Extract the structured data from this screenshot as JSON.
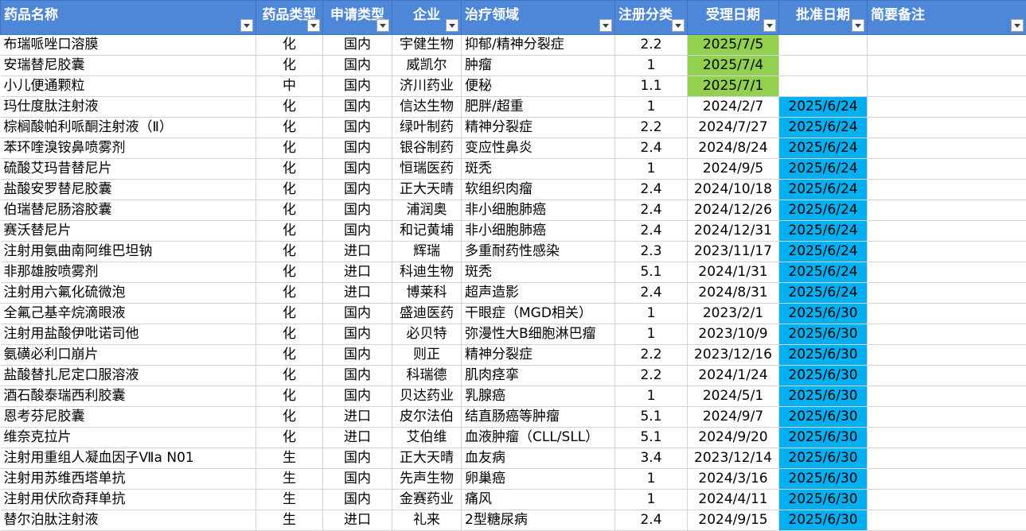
{
  "columns": [
    "药品名称",
    "药品类型",
    "申请类型",
    "企业",
    "治疗领域",
    "注册分类",
    "受理日期",
    "批准日期",
    "简要备注"
  ],
  "colors": {
    "header": "#4e86d8",
    "accepted_highlight": "#92d050",
    "approved_highlight": "#00b0f0"
  },
  "icons": {
    "filter": "chevron-down-icon"
  },
  "rows": [
    {
      "name": "布瑞哌唑口溶膜",
      "drug_type": "化",
      "app_type": "国内",
      "company": "宇健生物",
      "area": "抑郁/精神分裂症",
      "reg_class": "2.2",
      "accept_date": "2025/7/5",
      "approve_date": "",
      "note": ""
    },
    {
      "name": "安瑞替尼胶囊",
      "drug_type": "化",
      "app_type": "国内",
      "company": "威凯尔",
      "area": "肿瘤",
      "reg_class": "1",
      "accept_date": "2025/7/4",
      "approve_date": "",
      "note": ""
    },
    {
      "name": "小儿便通颗粒",
      "drug_type": "中",
      "app_type": "国内",
      "company": "济川药业",
      "area": "便秘",
      "reg_class": "1.1",
      "accept_date": "2025/7/1",
      "approve_date": "",
      "note": ""
    },
    {
      "name": "玛仕度肽注射液",
      "drug_type": "化",
      "app_type": "国内",
      "company": "信达生物",
      "area": "肥胖/超重",
      "reg_class": "1",
      "accept_date": "2024/2/7",
      "approve_date": "2025/6/24",
      "note": ""
    },
    {
      "name": "棕榈酸帕利哌酮注射液（Ⅱ）",
      "drug_type": "化",
      "app_type": "国内",
      "company": "绿叶制药",
      "area": "精神分裂症",
      "reg_class": "2.2",
      "accept_date": "2024/7/27",
      "approve_date": "2025/6/24",
      "note": ""
    },
    {
      "name": "苯环喹溴铵鼻喷雾剂",
      "drug_type": "化",
      "app_type": "国内",
      "company": "银谷制药",
      "area": "变应性鼻炎",
      "reg_class": "2.4",
      "accept_date": "2024/8/24",
      "approve_date": "2025/6/24",
      "note": ""
    },
    {
      "name": "硫酸艾玛昔替尼片",
      "drug_type": "化",
      "app_type": "国内",
      "company": "恒瑞医药",
      "area": "斑秃",
      "reg_class": "1",
      "accept_date": "2024/9/5",
      "approve_date": "2025/6/24",
      "note": ""
    },
    {
      "name": "盐酸安罗替尼胶囊",
      "drug_type": "化",
      "app_type": "国内",
      "company": "正大天晴",
      "area": "软组织肉瘤",
      "reg_class": "2.4",
      "accept_date": "2024/10/18",
      "approve_date": "2025/6/24",
      "note": ""
    },
    {
      "name": "伯瑞替尼肠溶胶囊",
      "drug_type": "化",
      "app_type": "国内",
      "company": "浦润奥",
      "area": "非小细胞肺癌",
      "reg_class": "2.4",
      "accept_date": "2024/12/26",
      "approve_date": "2025/6/24",
      "note": ""
    },
    {
      "name": "赛沃替尼片",
      "drug_type": "化",
      "app_type": "国内",
      "company": "和记黄埔",
      "area": "非小细胞肺癌",
      "reg_class": "2.4",
      "accept_date": "2024/12/31",
      "approve_date": "2025/6/24",
      "note": ""
    },
    {
      "name": "注射用氨曲南阿维巴坦钠",
      "drug_type": "化",
      "app_type": "进口",
      "company": "辉瑞",
      "area": "多重耐药性感染",
      "reg_class": "2.3",
      "accept_date": "2023/11/17",
      "approve_date": "2025/6/24",
      "note": ""
    },
    {
      "name": "非那雄胺喷雾剂",
      "drug_type": "化",
      "app_type": "进口",
      "company": "科迪生物",
      "area": "斑秃",
      "reg_class": "5.1",
      "accept_date": "2024/1/31",
      "approve_date": "2025/6/24",
      "note": ""
    },
    {
      "name": "注射用六氟化硫微泡",
      "drug_type": "化",
      "app_type": "进口",
      "company": "博莱科",
      "area": "超声造影",
      "reg_class": "2.4",
      "accept_date": "2024/8/31",
      "approve_date": "2025/6/24",
      "note": ""
    },
    {
      "name": "全氟己基辛烷滴眼液",
      "drug_type": "化",
      "app_type": "国内",
      "company": "盛迪医药",
      "area": "干眼症（MGD相关）",
      "reg_class": "1",
      "accept_date": "2023/2/1",
      "approve_date": "2025/6/30",
      "note": ""
    },
    {
      "name": "注射用盐酸伊吡诺司他",
      "drug_type": "化",
      "app_type": "国内",
      "company": "必贝特",
      "area": "弥漫性大B细胞淋巴瘤",
      "reg_class": "1",
      "accept_date": "2023/10/9",
      "approve_date": "2025/6/30",
      "note": ""
    },
    {
      "name": "氨磺必利口崩片",
      "drug_type": "化",
      "app_type": "国内",
      "company": "则正",
      "area": "精神分裂症",
      "reg_class": "2.2",
      "accept_date": "2023/12/16",
      "approve_date": "2025/6/30",
      "note": ""
    },
    {
      "name": "盐酸替扎尼定口服溶液",
      "drug_type": "化",
      "app_type": "国内",
      "company": "科瑞德",
      "area": "肌肉痉挛",
      "reg_class": "2.2",
      "accept_date": "2024/1/24",
      "approve_date": "2025/6/30",
      "note": ""
    },
    {
      "name": "酒石酸泰瑞西利胶囊",
      "drug_type": "化",
      "app_type": "国内",
      "company": "贝达药业",
      "area": "乳腺癌",
      "reg_class": "1",
      "accept_date": "2024/5/1",
      "approve_date": "2025/6/30",
      "note": ""
    },
    {
      "name": "恩考芬尼胶囊",
      "drug_type": "化",
      "app_type": "进口",
      "company": "皮尔法伯",
      "area": "结直肠癌等肿瘤",
      "reg_class": "5.1",
      "accept_date": "2024/9/7",
      "approve_date": "2025/6/30",
      "note": ""
    },
    {
      "name": "维奈克拉片",
      "drug_type": "化",
      "app_type": "进口",
      "company": "艾伯维",
      "area": "血液肿瘤（CLL/SLL）",
      "reg_class": "5.1",
      "accept_date": "2024/9/20",
      "approve_date": "2025/6/30",
      "note": ""
    },
    {
      "name": "注射用重组人凝血因子Ⅶa N01",
      "drug_type": "生",
      "app_type": "国内",
      "company": "正大天晴",
      "area": "血友病",
      "reg_class": "3.4",
      "accept_date": "2023/12/14",
      "approve_date": "2025/6/30",
      "note": ""
    },
    {
      "name": "注射用苏维西塔单抗",
      "drug_type": "生",
      "app_type": "国内",
      "company": "先声生物",
      "area": "卵巢癌",
      "reg_class": "1",
      "accept_date": "2024/3/16",
      "approve_date": "2025/6/30",
      "note": ""
    },
    {
      "name": "注射用伏欣奇拜单抗",
      "drug_type": "生",
      "app_type": "国内",
      "company": "金赛药业",
      "area": "痛风",
      "reg_class": "1",
      "accept_date": "2024/4/11",
      "approve_date": "2025/6/30",
      "note": ""
    },
    {
      "name": "替尔泊肽注射液",
      "drug_type": "生",
      "app_type": "进口",
      "company": "礼来",
      "area": "2型糖尿病",
      "reg_class": "2.4",
      "accept_date": "2024/9/15",
      "approve_date": "2025/6/30",
      "note": ""
    }
  ]
}
